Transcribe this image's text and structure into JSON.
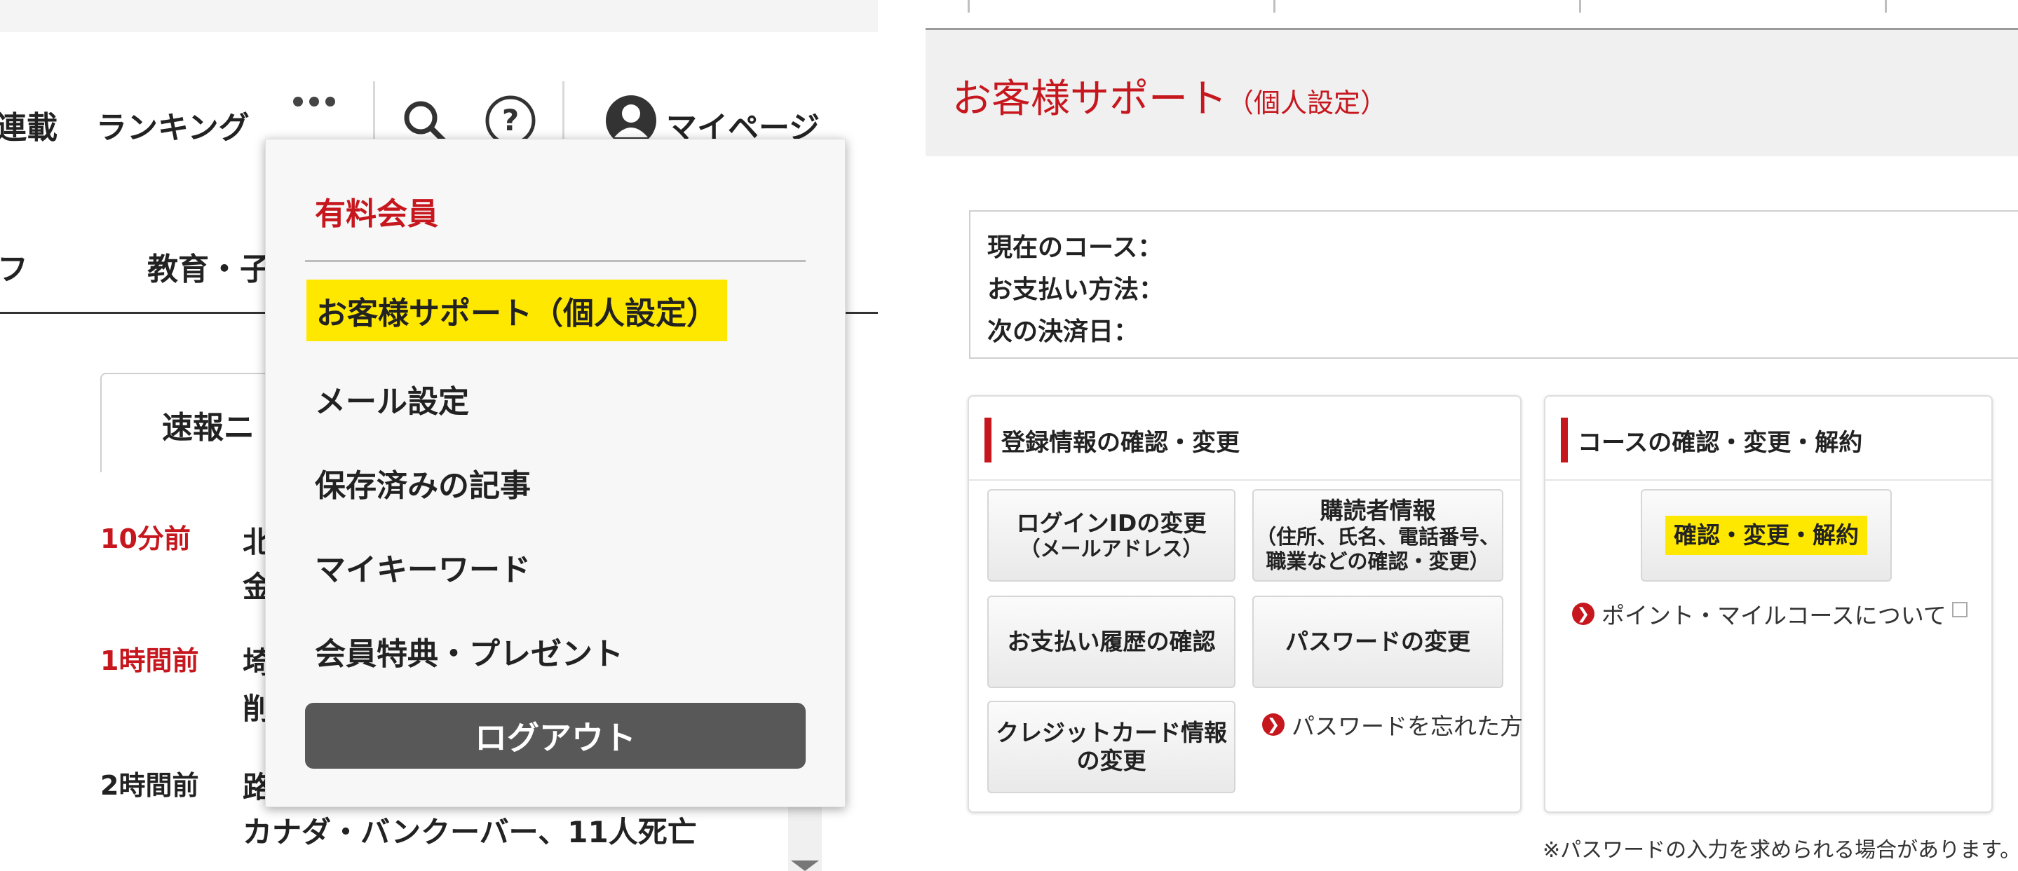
{
  "left": {
    "nav": {
      "serial": "連載",
      "ranking": "ランキング",
      "mypage": "マイページ"
    },
    "category_partial_1": "フ",
    "category_partial_2": "教育・子",
    "tab_partial": "速報ニ",
    "news": [
      {
        "time": "10分前",
        "line1": "北",
        "line2": "金"
      },
      {
        "time": "1時間前",
        "line1": "埼",
        "line2": "削"
      },
      {
        "time": "2時間前",
        "line1": "路",
        "line2": "カナダ・バンクーバー、11人死亡"
      }
    ],
    "dropdown": {
      "paid_member": "有料会員",
      "support": "お客様サポート（個人設定）",
      "mail_settings": "メール設定",
      "saved_articles": "保存済みの記事",
      "my_keywords": "マイキーワード",
      "member_benefits": "会員特典・プレゼント",
      "logout": "ログアウト"
    },
    "colors": {
      "accent": "#c7171e",
      "highlight": "#ffe800"
    }
  },
  "right": {
    "title": "お客様サポート",
    "title_sub": "（個人設定）",
    "info": {
      "current_course": "現在のコース：",
      "payment_method": "お支払い方法：",
      "next_payment": "次の決済日："
    },
    "registration": {
      "heading": "登録情報の確認・変更",
      "login_id_change": "ログインIDの変更",
      "login_id_sub": "（メールアドレス）",
      "subscriber_info": "購読者情報",
      "subscriber_sub1": "（住所、氏名、電話番号、",
      "subscriber_sub2": "職業などの確認・変更）",
      "payment_history": "お支払い履歴の確認",
      "password_change": "パスワードの変更",
      "credit_card_1": "クレジットカード情報",
      "credit_card_2": "の変更",
      "forgot_password": "パスワードを忘れた方"
    },
    "course": {
      "heading": "コースの確認・変更・解約",
      "confirm_button": "確認・変更・解約",
      "points_link": "ポイント・マイルコースについて"
    },
    "note": "※パスワードの入力を求められる場合があります。"
  }
}
